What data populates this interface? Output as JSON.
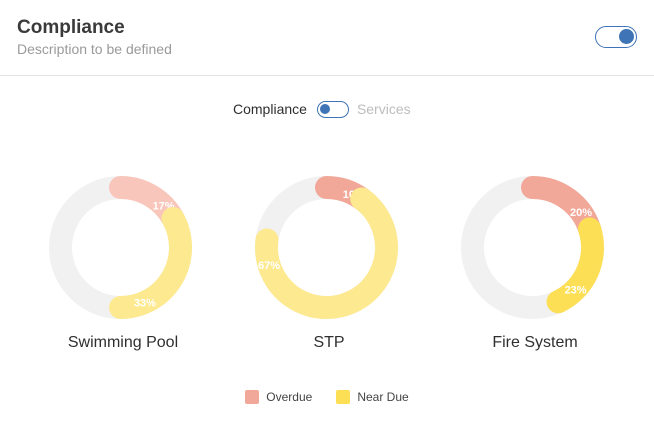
{
  "header": {
    "title": "Compliance",
    "subtitle": "Description to be defined"
  },
  "view_switch": {
    "active_label": "Compliance",
    "inactive_label": "Services"
  },
  "colors": {
    "overdue": "#f2a898",
    "near_due": "#fddf55",
    "track": "#f1f1f1",
    "accent": "#3f74b6"
  },
  "legend": [
    {
      "label": "Overdue",
      "color": "#f2a898"
    },
    {
      "label": "Near Due",
      "color": "#fddf55"
    }
  ],
  "chart_data": [
    {
      "type": "donut",
      "title": "Swimming Pool",
      "series": [
        {
          "name": "Overdue",
          "value": 17,
          "label": "17%",
          "color": "#f9c6bb"
        },
        {
          "name": "Near Due",
          "value": 33,
          "label": "33%",
          "color": "#fde98f"
        }
      ]
    },
    {
      "type": "donut",
      "title": "STP",
      "series": [
        {
          "name": "Overdue",
          "value": 10,
          "label": "10%",
          "color": "#f2a898"
        },
        {
          "name": "Near Due",
          "value": 67,
          "label": "67%",
          "color": "#fde98f"
        }
      ]
    },
    {
      "type": "donut",
      "title": "Fire System",
      "series": [
        {
          "name": "Overdue",
          "value": 20,
          "label": "20%",
          "color": "#f2a898"
        },
        {
          "name": "Near Due",
          "value": 23,
          "label": "23%",
          "color": "#fddf55"
        }
      ]
    }
  ]
}
